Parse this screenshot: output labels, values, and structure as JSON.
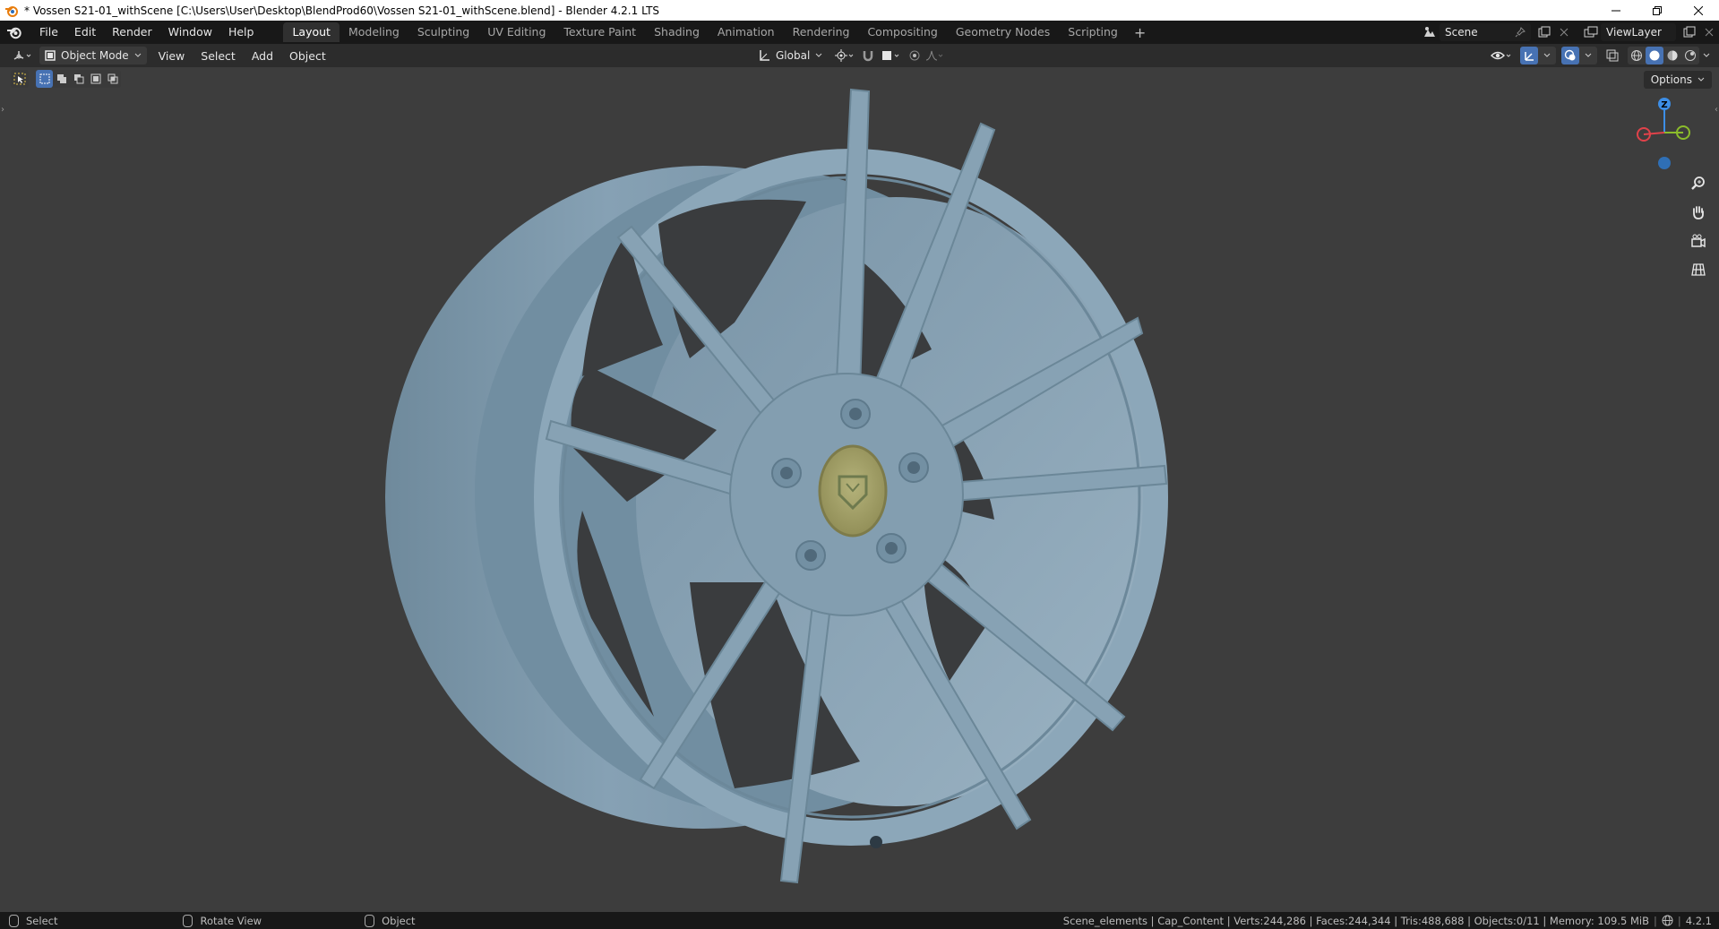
{
  "window": {
    "title": "* Vossen S21-01_withScene [C:\\Users\\User\\Desktop\\BlendProd60\\Vossen S21-01_withScene.blend] - Blender 4.2.1 LTS"
  },
  "menu": {
    "file": "File",
    "edit": "Edit",
    "render": "Render",
    "window": "Window",
    "help": "Help"
  },
  "workspaces": [
    {
      "label": "Layout",
      "active": true
    },
    {
      "label": "Modeling"
    },
    {
      "label": "Sculpting"
    },
    {
      "label": "UV Editing"
    },
    {
      "label": "Texture Paint"
    },
    {
      "label": "Shading"
    },
    {
      "label": "Animation"
    },
    {
      "label": "Rendering"
    },
    {
      "label": "Compositing"
    },
    {
      "label": "Geometry Nodes"
    },
    {
      "label": "Scripting"
    }
  ],
  "scene": {
    "name": "Scene"
  },
  "view_layer": {
    "name": "ViewLayer"
  },
  "viewport_header": {
    "mode": "Object Mode",
    "menus": {
      "view": "View",
      "select": "Select",
      "add": "Add",
      "object": "Object"
    },
    "transform_orientation": "Global"
  },
  "options_label": "Options",
  "gizmo": {
    "z": "Z"
  },
  "statusbar": {
    "select": "Select",
    "rotate_view": "Rotate View",
    "object": "Object",
    "stats": "Scene_elements | Cap_Content | Verts:244,286 | Faces:244,344 | Tris:488,688 | Objects:0/11 | Memory: 109.5 MiB",
    "version": "4.2.1"
  },
  "colors": {
    "viewport_bg": "#3d3d3d",
    "wheel": "#7f9bae",
    "center_cap": "#a7a56a",
    "accent_blue": "#4772b3",
    "axis_x": "#e0424a",
    "axis_y": "#8bbc2b",
    "axis_z": "#3d8ee6"
  }
}
